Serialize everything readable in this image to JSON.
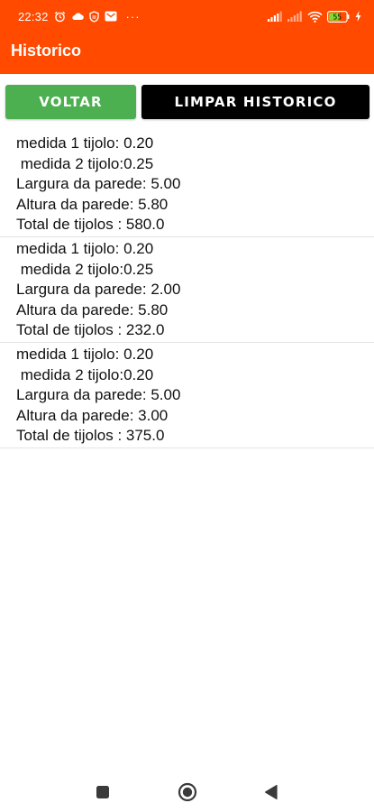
{
  "status_bar": {
    "time": "22:32",
    "battery": "55"
  },
  "app_bar": {
    "title": "Historico"
  },
  "buttons": {
    "voltar": "VOLTAR",
    "limpar": "LIMPAR HISTORICO"
  },
  "history": [
    {
      "medida1": "medida 1 tijolo: 0.20",
      "medida2": " medida 2 tijolo:0.25",
      "largura": "Largura da parede: 5.00",
      "altura": "Altura da parede: 5.80",
      "total": "Total de tijolos : 580.0"
    },
    {
      "medida1": "medida 1 tijolo: 0.20",
      "medida2": " medida 2 tijolo:0.25",
      "largura": "Largura da parede: 2.00",
      "altura": "Altura da parede: 5.80",
      "total": "Total de tijolos : 232.0"
    },
    {
      "medida1": "medida 1 tijolo: 0.20",
      "medida2": " medida 2 tijolo:0.20",
      "largura": "Largura da parede: 5.00",
      "altura": "Altura da parede: 3.00",
      "total": "Total de tijolos : 375.0"
    }
  ],
  "colors": {
    "app_bar": "#ff4a00",
    "voltar_button": "#4caf50",
    "limpar_button": "#000000"
  }
}
